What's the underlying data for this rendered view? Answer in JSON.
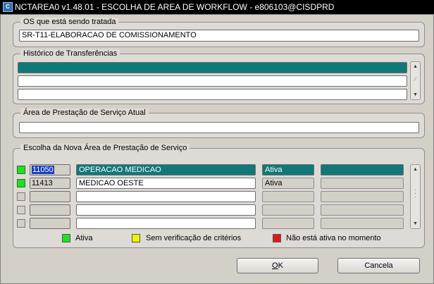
{
  "window": {
    "title": "NCTAREA0 v1.48.01 - ESCOLHA DE AREA DE WORKFLOW  - e806103@CISDPRD",
    "icon_text": "C"
  },
  "os_group": {
    "label": "OS que está sendo tratada",
    "value": "SR-T11-ELABORACAO DE COMISSIONAMENTO"
  },
  "historico_group": {
    "label": "Histórico de Transferências",
    "rows": [
      "",
      "",
      ""
    ]
  },
  "area_atual_group": {
    "label": "Área de Prestação de Serviço Atual",
    "value": ""
  },
  "nova_area_group": {
    "label": "Escolha da Nova Área de Prestação de Serviço",
    "rows": [
      {
        "code": "11050",
        "name": "OPERACAO MEDICAO",
        "status": "Ativa",
        "extra": "",
        "indicator": "green"
      },
      {
        "code": "11413",
        "name": "MEDICAO OESTE",
        "status": "Ativa",
        "extra": "",
        "indicator": "green"
      },
      {
        "code": "",
        "name": "",
        "status": "",
        "extra": "",
        "indicator": "none"
      },
      {
        "code": "",
        "name": "",
        "status": "",
        "extra": "",
        "indicator": "none"
      },
      {
        "code": "",
        "name": "",
        "status": "",
        "extra": "",
        "indicator": "none"
      }
    ]
  },
  "legend": {
    "ativa": {
      "label": "Ativa",
      "color": "#22e022"
    },
    "sem_verificacao": {
      "label": "Sem verificação de critérios",
      "color": "#f2f200"
    },
    "nao_ativa": {
      "label": "Não está ativa no momento",
      "color": "#e01818"
    }
  },
  "buttons": {
    "ok": {
      "label_underlined": "O",
      "label_rest": "K"
    },
    "cancel": {
      "label": "Cancela"
    }
  },
  "colors": {
    "selection": "#117878",
    "code_highlight": "#1b3fbf",
    "indicator_green": "#1ee01e"
  }
}
